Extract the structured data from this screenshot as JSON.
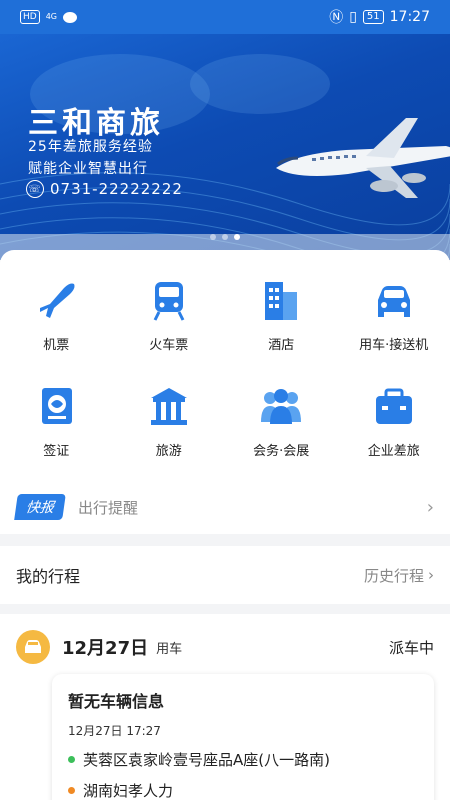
{
  "statusbar": {
    "left_badge": "HD",
    "network": "4G",
    "time": "17:27",
    "battery": "51"
  },
  "banner": {
    "title": "三和商旅",
    "subtitle1": "25年差旅服务经验",
    "subtitle2": "赋能企业智慧出行",
    "phone": "0731-22222222",
    "slides": 3,
    "active_slide": 3
  },
  "services": [
    {
      "label": "机票",
      "icon": "airplane-icon"
    },
    {
      "label": "火车票",
      "icon": "train-icon"
    },
    {
      "label": "酒店",
      "icon": "hotel-icon"
    },
    {
      "label": "用车·接送机",
      "icon": "car-icon"
    },
    {
      "label": "签证",
      "icon": "passport-icon"
    },
    {
      "label": "旅游",
      "icon": "temple-icon"
    },
    {
      "label": "会务·会展",
      "icon": "group-icon"
    },
    {
      "label": "企业差旅",
      "icon": "briefcase-icon"
    }
  ],
  "kuaibao": {
    "tag": "快报",
    "text": "出行提醒"
  },
  "trips": {
    "title": "我的行程",
    "history": "历史行程",
    "card": {
      "date": "12月27日",
      "type": "用车",
      "status": "派车中",
      "inner_title": "暂无车辆信息",
      "time": "12月27日 17:27",
      "from": "芙蓉区袁家岭壹号座品A座(八一路南)",
      "to": "湖南妇孝人力"
    }
  },
  "colors": {
    "primary": "#1f6fd8",
    "accent_blue": "#2a7ee6",
    "badge_yellow": "#f5b942",
    "green": "#3cbf5a",
    "orange": "#f08a24"
  }
}
